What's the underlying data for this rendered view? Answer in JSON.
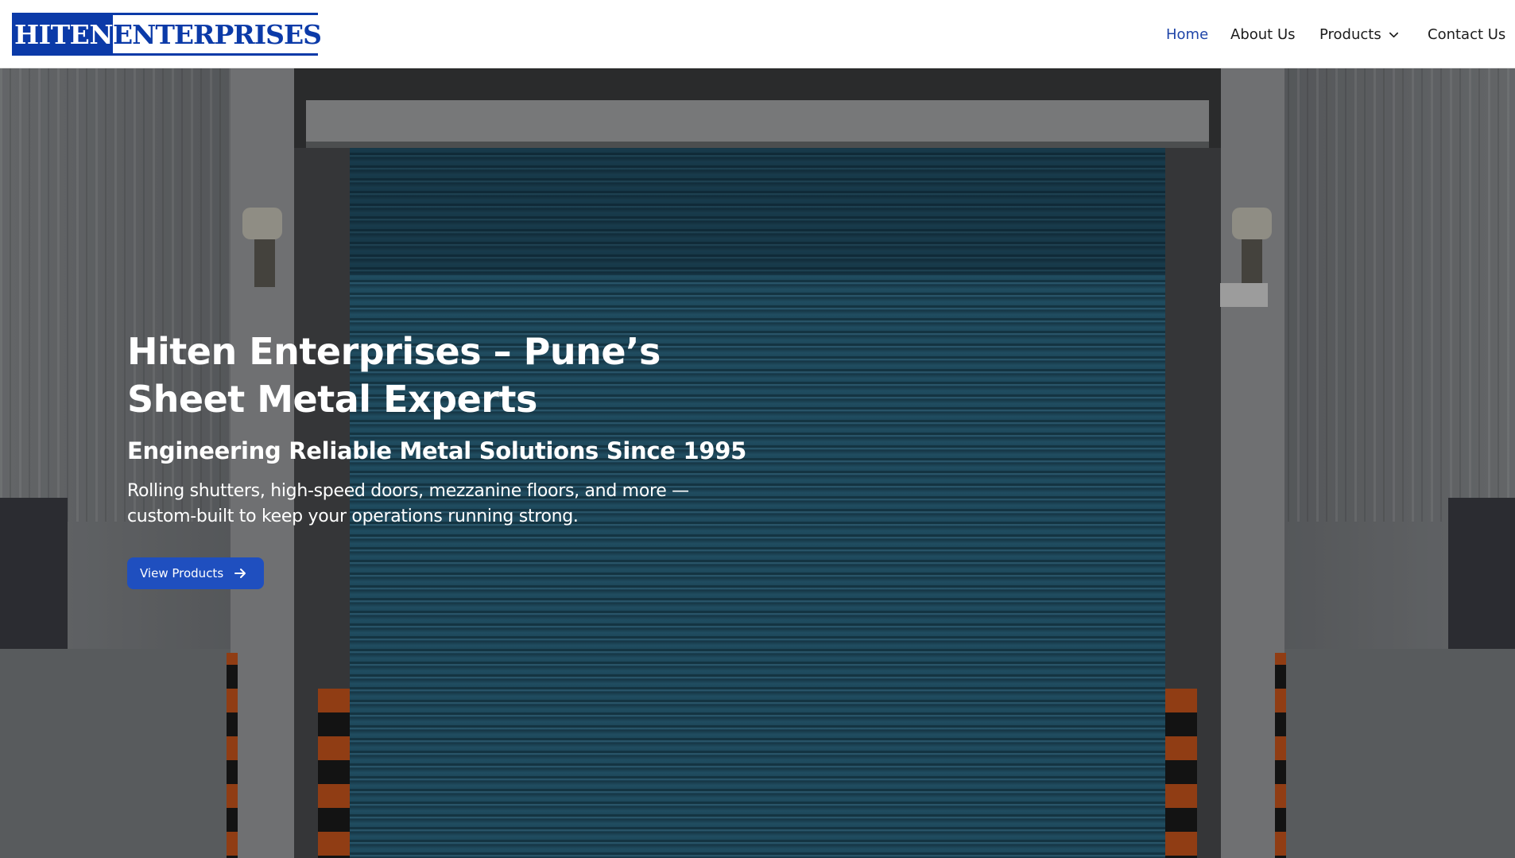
{
  "header": {
    "logo": {
      "left": "HITEN",
      "right": "ENTERPRISES"
    },
    "nav": [
      {
        "label": "Home",
        "active": true
      },
      {
        "label": "About Us"
      },
      {
        "label": "Products",
        "icon": "chevron-down-icon"
      },
      {
        "label": "Contact Us"
      }
    ]
  },
  "hero": {
    "title": "Hiten Enterprises – Pune’s Sheet Metal Experts",
    "subtitle": "Engineering Reliable Metal Solutions Since 1995",
    "description": "Rolling shutters, high-speed doors, mezzanine floors, and more — custom-built to keep your operations running strong.",
    "cta_label": "View Products",
    "cta_icon": "arrow-right-icon"
  },
  "colors": {
    "brand": "#0b3aa8",
    "nav_active": "#1f45a8",
    "button": "#1f4fbf",
    "shutter": "#2c6a86"
  }
}
